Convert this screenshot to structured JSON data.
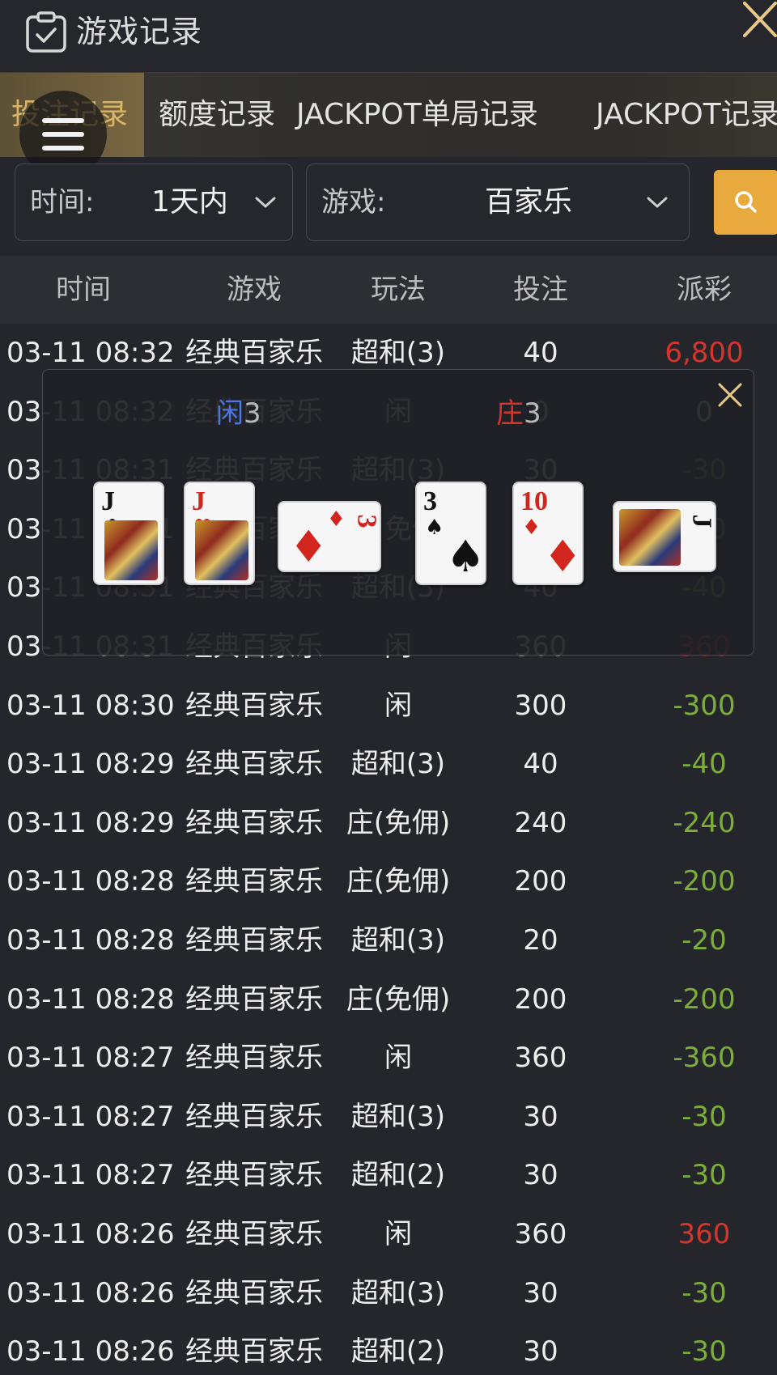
{
  "header": {
    "title": "游戏记录",
    "icon": "clipboard-check-icon",
    "close_icon": "close-icon"
  },
  "tabs": [
    {
      "label": "投注记录",
      "active": true
    },
    {
      "label": "额度记录",
      "active": false
    },
    {
      "label": "JACKPOT单局记录",
      "active": false
    },
    {
      "label": "JACKPOT记录",
      "active": false
    }
  ],
  "filters": {
    "time": {
      "label": "时间:",
      "value": "1天内"
    },
    "game": {
      "label": "游戏:",
      "value": "百家乐"
    },
    "search_icon": "search-icon"
  },
  "table": {
    "headers": [
      "时间",
      "游戏",
      "玩法",
      "投注",
      "派彩"
    ],
    "rows": [
      {
        "time": "03-11 08:32",
        "game": "经典百家乐",
        "play": "超和(3)",
        "bet": "40",
        "payout": "6,800",
        "result": "win"
      },
      {
        "time": "03-11 08:32",
        "game": "经典百家乐",
        "play": "闲",
        "bet": "0",
        "payout": "0",
        "result": "neutral"
      },
      {
        "time": "03-11 08:31",
        "game": "经典百家乐",
        "play": "超和(3)",
        "bet": "30",
        "payout": "-30",
        "result": "lose"
      },
      {
        "time": "03-11 08:31",
        "game": "经典百家乐",
        "play": "庄(免佣)",
        "bet": "40",
        "payout": "-40",
        "result": "lose"
      },
      {
        "time": "03-11 08:31",
        "game": "经典百家乐",
        "play": "超和(3)",
        "bet": "40",
        "payout": "-40",
        "result": "lose"
      },
      {
        "time": "03-11 08:31",
        "game": "经典百家乐",
        "play": "闲",
        "bet": "360",
        "payout": "360",
        "result": "win"
      },
      {
        "time": "03-11 08:30",
        "game": "经典百家乐",
        "play": "闲",
        "bet": "300",
        "payout": "-300",
        "result": "lose"
      },
      {
        "time": "03-11 08:29",
        "game": "经典百家乐",
        "play": "超和(3)",
        "bet": "40",
        "payout": "-40",
        "result": "lose"
      },
      {
        "time": "03-11 08:29",
        "game": "经典百家乐",
        "play": "庄(免佣)",
        "bet": "240",
        "payout": "-240",
        "result": "lose"
      },
      {
        "time": "03-11 08:28",
        "game": "经典百家乐",
        "play": "庄(免佣)",
        "bet": "200",
        "payout": "-200",
        "result": "lose"
      },
      {
        "time": "03-11 08:28",
        "game": "经典百家乐",
        "play": "超和(3)",
        "bet": "20",
        "payout": "-20",
        "result": "lose"
      },
      {
        "time": "03-11 08:28",
        "game": "经典百家乐",
        "play": "庄(免佣)",
        "bet": "200",
        "payout": "-200",
        "result": "lose"
      },
      {
        "time": "03-11 08:27",
        "game": "经典百家乐",
        "play": "闲",
        "bet": "360",
        "payout": "-360",
        "result": "lose"
      },
      {
        "time": "03-11 08:27",
        "game": "经典百家乐",
        "play": "超和(3)",
        "bet": "30",
        "payout": "-30",
        "result": "lose"
      },
      {
        "time": "03-11 08:27",
        "game": "经典百家乐",
        "play": "超和(2)",
        "bet": "30",
        "payout": "-30",
        "result": "lose"
      },
      {
        "time": "03-11 08:26",
        "game": "经典百家乐",
        "play": "闲",
        "bet": "360",
        "payout": "360",
        "result": "win"
      },
      {
        "time": "03-11 08:26",
        "game": "经典百家乐",
        "play": "超和(3)",
        "bet": "30",
        "payout": "-30",
        "result": "lose"
      },
      {
        "time": "03-11 08:26",
        "game": "经典百家乐",
        "play": "超和(2)",
        "bet": "30",
        "payout": "-30",
        "result": "lose"
      }
    ]
  },
  "popup": {
    "player_label": "闲",
    "player_score": "3",
    "banker_label": "庄",
    "banker_score": "3",
    "player_color": "#4a78e0",
    "banker_color": "#d7352c",
    "player_cards": [
      {
        "rank": "J",
        "suit": "♣",
        "color": "black",
        "rotated": false
      },
      {
        "rank": "J",
        "suit": "♥",
        "color": "red",
        "rotated": false
      },
      {
        "rank": "3",
        "suit": "♦",
        "color": "red",
        "rotated": true
      }
    ],
    "banker_cards": [
      {
        "rank": "3",
        "suit": "♠",
        "color": "black",
        "rotated": false
      },
      {
        "rank": "10",
        "suit": "♦",
        "color": "red",
        "rotated": false
      },
      {
        "rank": "J",
        "suit": "♣",
        "color": "black",
        "rotated": true
      }
    ]
  },
  "colors": {
    "accent": "#e8aa3c",
    "win": "#d7352c",
    "lose": "#7cae3a",
    "tab_active": "#d8b567"
  }
}
